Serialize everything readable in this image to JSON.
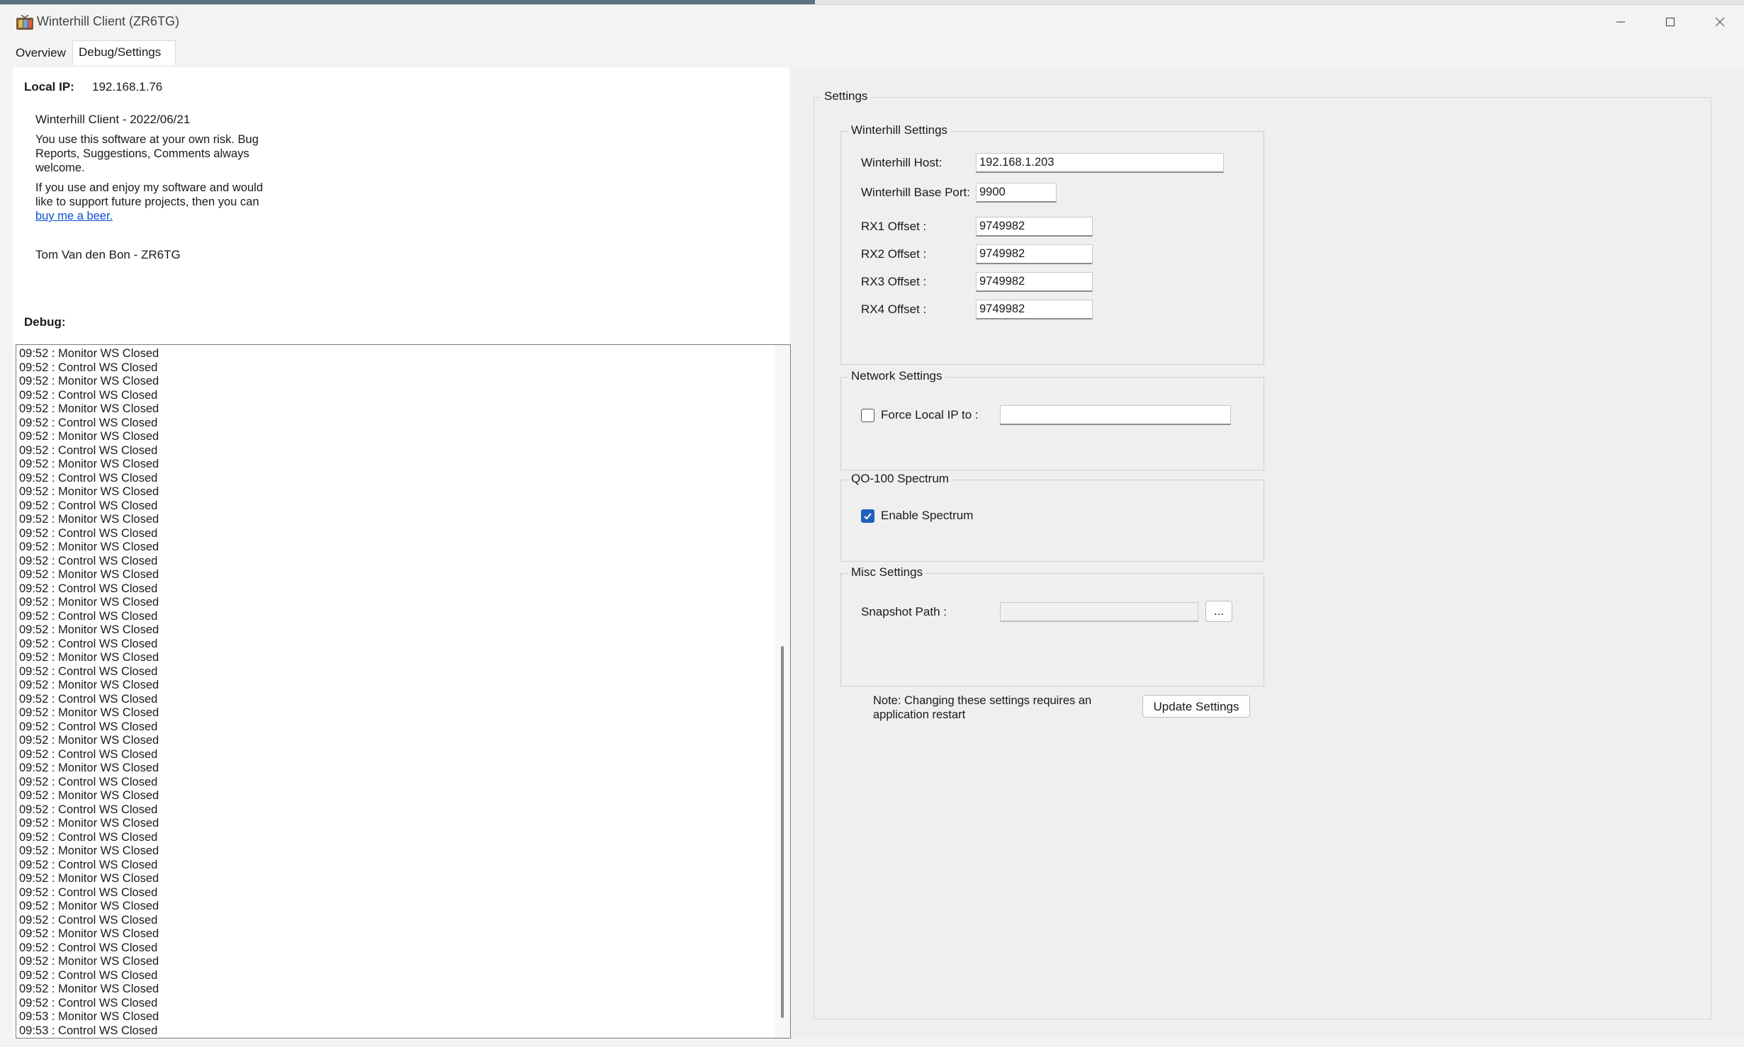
{
  "window": {
    "title": "Winterhill Client (ZR6TG)"
  },
  "tabs": [
    {
      "label": "Overview"
    },
    {
      "label": "Debug/Settings"
    }
  ],
  "info": {
    "local_ip_label": "Local IP:",
    "local_ip_value": "192.168.1.76",
    "version": "Winterhill Client - 2022/06/21",
    "disclaimer": "You use this software at your own risk. Bug Reports, Suggestions, Comments always welcome.",
    "support_text": "If you use and enjoy my software and would like to support future projects, then you can",
    "support_link": "buy me a beer.",
    "author": "Tom Van den Bon - ZR6TG"
  },
  "debug": {
    "label": "Debug:",
    "log": [
      "09:52 : Monitor WS Closed",
      "09:52 : Control WS Closed",
      "09:52 : Monitor WS Closed",
      "09:52 : Control WS Closed",
      "09:52 : Monitor WS Closed",
      "09:52 : Control WS Closed",
      "09:52 : Monitor WS Closed",
      "09:52 : Control WS Closed",
      "09:52 : Monitor WS Closed",
      "09:52 : Control WS Closed",
      "09:52 : Monitor WS Closed",
      "09:52 : Control WS Closed",
      "09:52 : Monitor WS Closed",
      "09:52 : Control WS Closed",
      "09:52 : Monitor WS Closed",
      "09:52 : Control WS Closed",
      "09:52 : Monitor WS Closed",
      "09:52 : Control WS Closed",
      "09:52 : Monitor WS Closed",
      "09:52 : Control WS Closed",
      "09:52 : Monitor WS Closed",
      "09:52 : Control WS Closed",
      "09:52 : Monitor WS Closed",
      "09:52 : Control WS Closed",
      "09:52 : Monitor WS Closed",
      "09:52 : Control WS Closed",
      "09:52 : Monitor WS Closed",
      "09:52 : Control WS Closed",
      "09:52 : Monitor WS Closed",
      "09:52 : Control WS Closed",
      "09:52 : Monitor WS Closed",
      "09:52 : Control WS Closed",
      "09:52 : Monitor WS Closed",
      "09:52 : Control WS Closed",
      "09:52 : Monitor WS Closed",
      "09:52 : Control WS Closed",
      "09:52 : Monitor WS Closed",
      "09:52 : Control WS Closed",
      "09:52 : Monitor WS Closed",
      "09:52 : Control WS Closed",
      "09:52 : Monitor WS Closed",
      "09:52 : Control WS Closed",
      "09:52 : Monitor WS Closed",
      "09:52 : Control WS Closed",
      "09:52 : Monitor WS Closed",
      "09:52 : Control WS Closed",
      "09:52 : Monitor WS Closed",
      "09:52 : Control WS Closed",
      "09:53 : Monitor WS Closed",
      "09:53 : Control WS Closed"
    ]
  },
  "settings": {
    "title": "Settings",
    "winterhill": {
      "title": "Winterhill Settings",
      "host_label": "Winterhill Host:",
      "host_value": "192.168.1.203",
      "port_label": "Winterhill Base Port:",
      "port_value": "9900",
      "offsets": [
        {
          "label": "RX1 Offset :",
          "value": "9749982"
        },
        {
          "label": "RX2 Offset :",
          "value": "9749982"
        },
        {
          "label": "RX3 Offset :",
          "value": "9749982"
        },
        {
          "label": "RX4 Offset :",
          "value": "9749982"
        }
      ]
    },
    "network": {
      "title": "Network Settings",
      "force_ip_label": "Force Local IP to :",
      "force_ip_checked": false,
      "force_ip_value": ""
    },
    "spectrum": {
      "title": "QO-100 Spectrum",
      "enable_label": "Enable Spectrum",
      "enable_checked": true
    },
    "misc": {
      "title": "Misc Settings",
      "snapshot_label": "Snapshot Path :",
      "snapshot_value": "",
      "browse_label": "..."
    },
    "note": "Note: Changing these settings requires an application restart",
    "update_button": "Update Settings"
  }
}
